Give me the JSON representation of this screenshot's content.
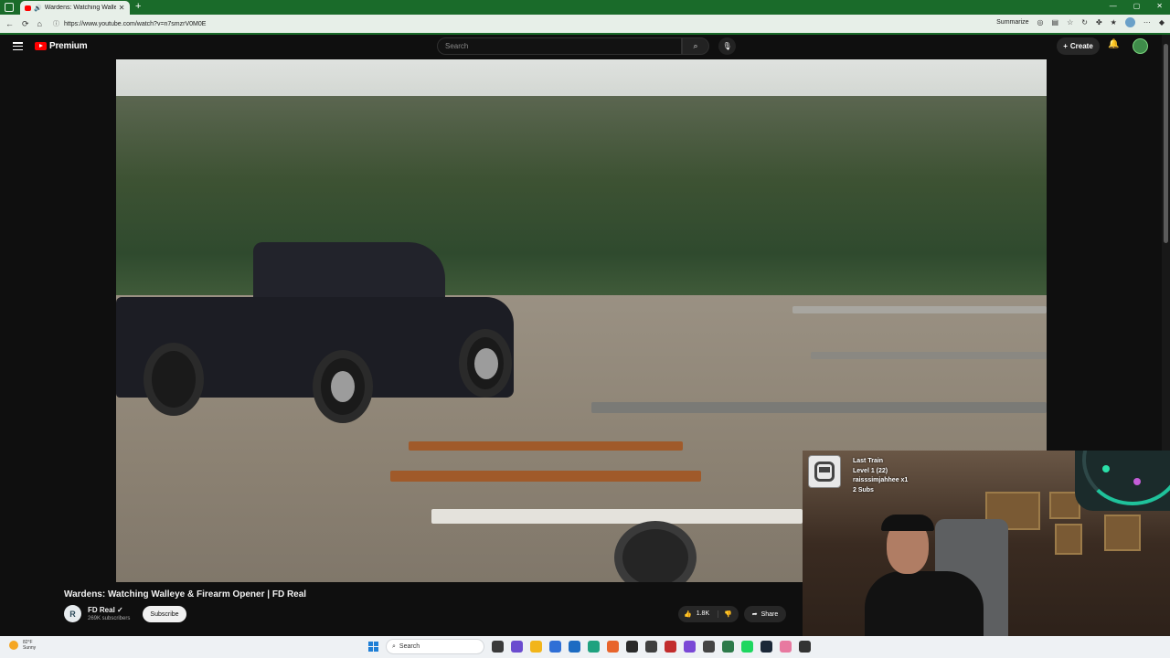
{
  "browser": {
    "tab_title": "Wardens: Watching Walleye",
    "new_tab": "+",
    "url": "https://www.youtube.com/watch?v=n7smzrV0M0E",
    "summarize_label": "Summarize",
    "window_controls": [
      "—",
      "▢",
      "✕"
    ]
  },
  "youtube": {
    "logo_text": "Premium",
    "search_placeholder": "Search",
    "create_label": "Create",
    "video_title": "Wardens: Watching Walleye & Firearm Opener | FD Real",
    "channel": {
      "name": "FD Real",
      "subscribers": "269K subscribers",
      "avatar_letter": "R"
    },
    "subscribe_label": "Subscribe",
    "likes": "1.8K",
    "share_label": "Share"
  },
  "overlay": {
    "alert_lines": [
      "Last Train",
      "Level 1  (22)",
      "raisssimjahhee x1",
      "2 Subs"
    ]
  },
  "taskbar": {
    "weather_temp": "82°F",
    "weather_desc": "Sunny",
    "search_label": "Search"
  },
  "colors": {
    "browser_accent": "#1a6b2a",
    "youtube_red": "#ff0000",
    "youtube_bg": "#0f0f0f"
  }
}
